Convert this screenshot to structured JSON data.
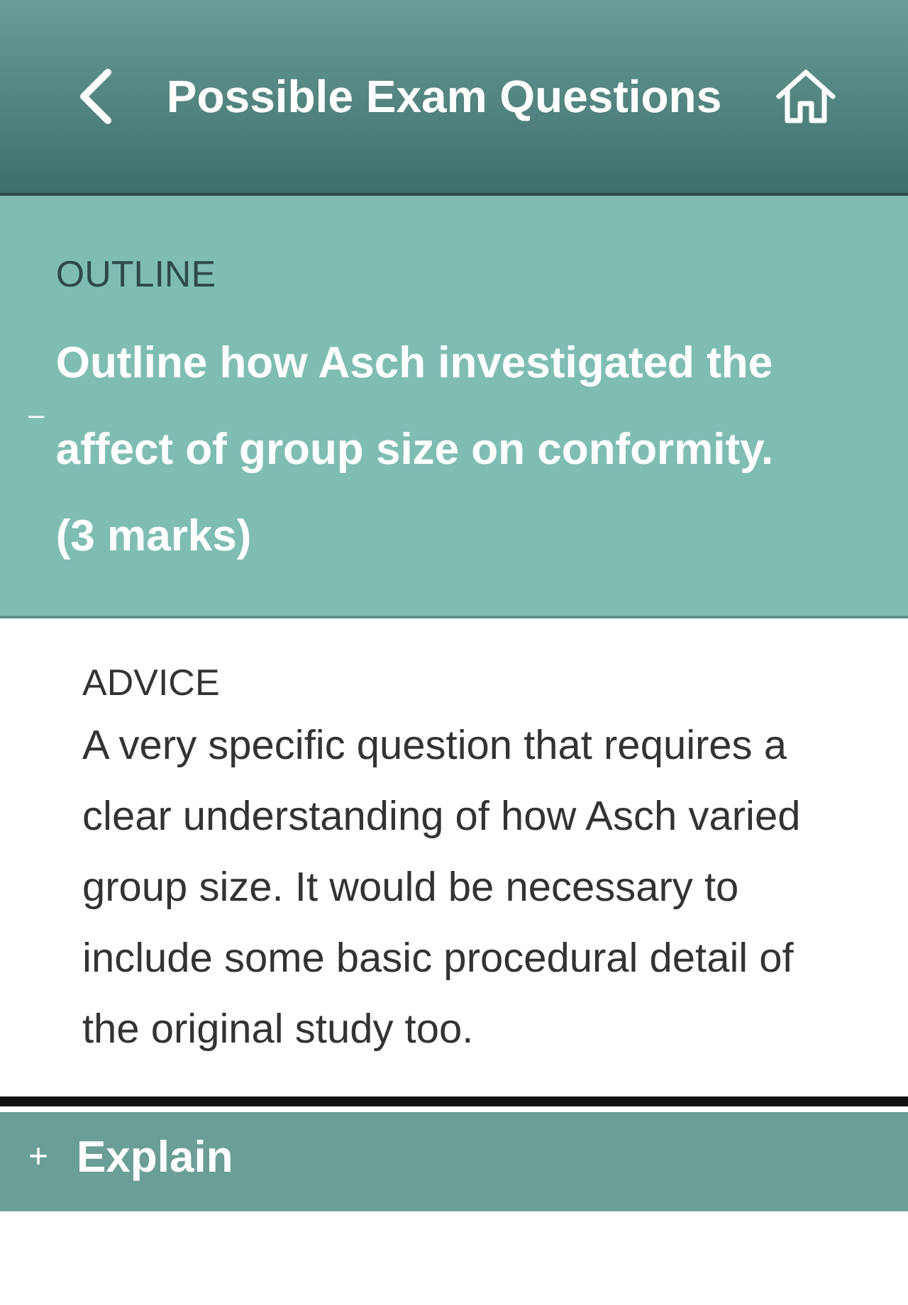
{
  "header": {
    "title": "Possible Exam Questions"
  },
  "questions": [
    {
      "toggle": "–",
      "expanded": true,
      "category": "OUTLINE",
      "question": "Outline how Asch investigated the affect of group size on conformity.",
      "marks": "(3 marks)",
      "advice": {
        "label": "ADVICE",
        "text": "A very specific question that requires a clear understanding of how Asch varied group size. It would be necessary to include some basic procedural detail of the original study too."
      }
    },
    {
      "toggle": "+",
      "expanded": false,
      "question": "Explain"
    }
  ]
}
